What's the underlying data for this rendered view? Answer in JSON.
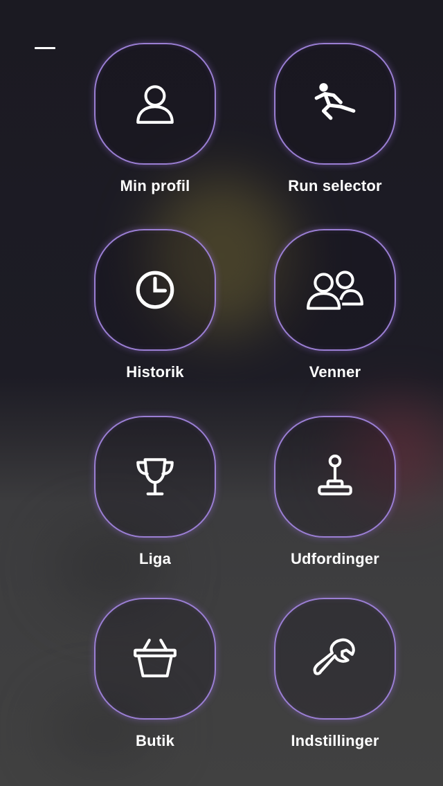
{
  "menu": {
    "close_icon": "dash-icon",
    "accent_color": "#9b7fd4",
    "items": [
      {
        "label": "Min profil",
        "icon": "user-icon"
      },
      {
        "label": "Run selector",
        "icon": "runner-icon"
      },
      {
        "label": "Historik",
        "icon": "clock-icon"
      },
      {
        "label": "Venner",
        "icon": "friends-icon"
      },
      {
        "label": "Liga",
        "icon": "trophy-icon"
      },
      {
        "label": "Udfordinger",
        "icon": "joystick-icon"
      },
      {
        "label": "Butik",
        "icon": "basket-icon"
      },
      {
        "label": "Indstillinger",
        "icon": "wrench-icon"
      }
    ]
  }
}
